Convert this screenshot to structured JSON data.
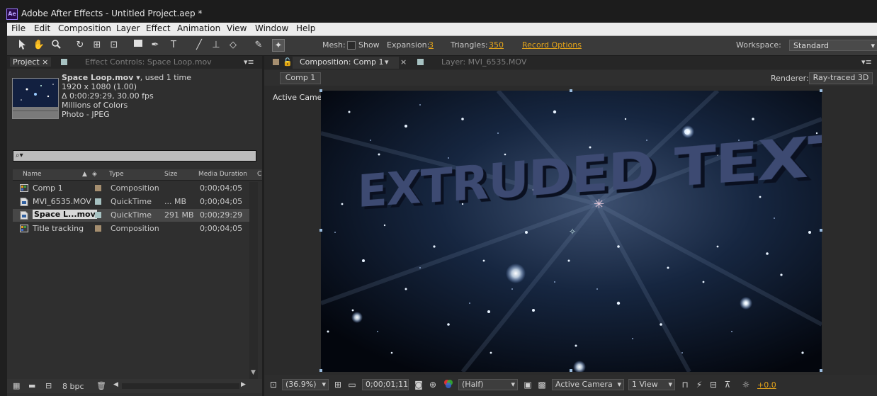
{
  "window": {
    "title": "Adobe After Effects - Untitled Project.aep *",
    "logo": "Ae"
  },
  "menu": [
    "File",
    "Edit",
    "Composition",
    "Layer",
    "Effect",
    "Animation",
    "View",
    "Window",
    "Help"
  ],
  "toolbar": {
    "mesh_label": "Mesh:",
    "show_label": "Show",
    "expansion_label": "Expansion:",
    "expansion_value": "3",
    "triangles_label": "Triangles:",
    "triangles_value": "350",
    "record_options": "Record Options",
    "workspace_label": "Workspace:",
    "workspace_value": "Standard"
  },
  "project_panel": {
    "tab_project": "Project",
    "tab_effect_controls": "Effect Controls: Space Loop.mov",
    "selected": {
      "name": "Space Loop.mov ▾",
      "used": ", used 1 time",
      "dims": "1920 x 1080 (1.00)",
      "duration": "Δ 0:00:29:29, 30.00 fps",
      "colors": "Millions of Colors",
      "codec": "Photo - JPEG"
    },
    "search_placeholder": "⌕▾",
    "columns": {
      "name": "Name",
      "type": "Type",
      "size": "Size",
      "duration": "Media Duration",
      "extra": "C"
    },
    "rows": [
      {
        "name": "Comp 1",
        "type": "Composition",
        "size": "",
        "duration": "0;00;04;05",
        "label_color": "#a58e6f",
        "kind": "comp"
      },
      {
        "name": "MVI_6535.MOV",
        "type": "QuickTime",
        "size": "... MB",
        "duration": "0;00;04;05",
        "label_color": "#a7c2c2",
        "kind": "footage"
      },
      {
        "name": "Space L...mov",
        "type": "QuickTime",
        "size": "291 MB",
        "duration": "0;00;29:29",
        "label_color": "#a7c2c2",
        "kind": "footage"
      },
      {
        "name": "Title tracking",
        "type": "Composition",
        "size": "",
        "duration": "0;00;04;05",
        "label_color": "#a58e6f",
        "kind": "comp"
      }
    ],
    "bpc": "8 bpc"
  },
  "comp_panel": {
    "tab_comp": "Composition: Comp 1",
    "tab_layer": "Layer: MVI_6535.MOV",
    "comp_button": "Comp 1",
    "renderer_label": "Renderer:",
    "renderer_value": "Ray-traced 3D",
    "active_camera": "Active Camera",
    "viewer_text": "EXTRUDED TEXT",
    "zoom": "(36.9%)",
    "timecode": "0;00;01;11",
    "resolution": "(Half)",
    "camera_select": "Active Camera",
    "views": "1 View",
    "exposure": "+0.0"
  },
  "colors": {
    "accent_orange": "#e2a31a",
    "comp_label": "#a58e6f",
    "footage_label": "#a7c2c2"
  }
}
